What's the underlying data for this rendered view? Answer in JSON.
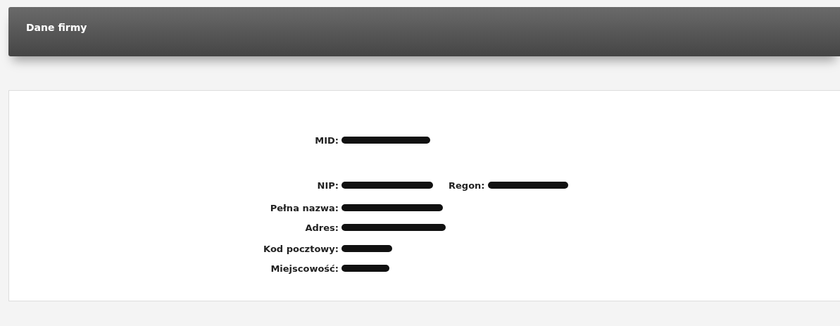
{
  "header": {
    "title": "Dane firmy"
  },
  "rows": [
    {
      "fields": [
        {
          "label": "MID:",
          "kind": "redacted"
        }
      ]
    },
    {
      "fields": [
        {
          "label": "NIP:",
          "kind": "redacted"
        },
        {
          "label": "Regon:",
          "kind": "redacted"
        }
      ]
    },
    {
      "fields": [
        {
          "label": "Pełna nazwa:",
          "kind": "redacted"
        }
      ]
    },
    {
      "fields": [
        {
          "label": "Adres:",
          "kind": "redacted"
        }
      ]
    },
    {
      "fields": [
        {
          "label": "Kod pocztowy:",
          "kind": "redacted"
        }
      ]
    },
    {
      "fields": [
        {
          "label": "Miejscowość:",
          "kind": "redacted"
        }
      ]
    }
  ]
}
